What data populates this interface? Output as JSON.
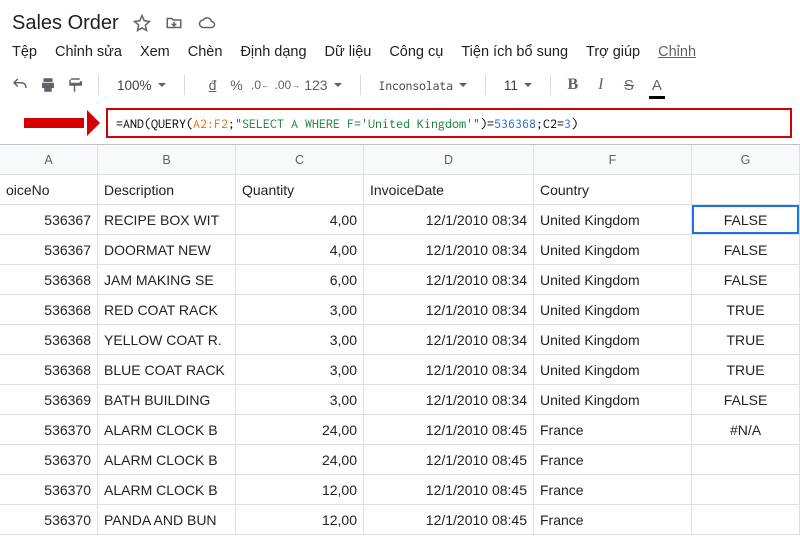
{
  "document": {
    "title": "Sales Order"
  },
  "menus": {
    "file": "Tệp",
    "edit": "Chỉnh sửa",
    "view": "Xem",
    "insert": "Chèn",
    "format": "Định dạng",
    "data": "Dữ liệu",
    "tools": "Công cụ",
    "addons": "Tiện ích bổ sung",
    "help": "Trợ giúp",
    "overflow": "Chỉnh"
  },
  "toolbar": {
    "zoom": "100%",
    "currency": "đ",
    "percent": "%",
    "dec_dec": ".0",
    "dec_inc": ".00",
    "num_format": "123",
    "font_name": "Inconsolata",
    "font_size": "11",
    "bold": "B",
    "italic": "I",
    "strike": "S",
    "text_color": "A"
  },
  "formula": {
    "p1": "=AND(QUERY(",
    "range": "A2:F2",
    "p2": ";",
    "str": "\"SELECT A WHERE F='United Kingdom'\"",
    "p3": ")=",
    "num1": "536368",
    "p4": ";C2=",
    "num2": "3",
    "p5": ")"
  },
  "columns": {
    "A": "A",
    "B": "B",
    "C": "C",
    "D": "D",
    "F": "F",
    "G": "G"
  },
  "headers": {
    "A": "oiceNo",
    "B": "Description",
    "C": "Quantity",
    "D": "InvoiceDate",
    "F": "Country",
    "G": ""
  },
  "rows": [
    {
      "A": "536367",
      "B": "RECIPE BOX WIT",
      "C": "4,00",
      "D": "12/1/2010 08:34",
      "F": "United Kingdom",
      "G": "FALSE",
      "sel": true
    },
    {
      "A": "536367",
      "B": "DOORMAT NEW",
      "C": "4,00",
      "D": "12/1/2010 08:34",
      "F": "United Kingdom",
      "G": "FALSE"
    },
    {
      "A": "536368",
      "B": "JAM MAKING SE",
      "C": "6,00",
      "D": "12/1/2010 08:34",
      "F": "United Kingdom",
      "G": "FALSE"
    },
    {
      "A": "536368",
      "B": "RED COAT RACK",
      "C": "3,00",
      "D": "12/1/2010 08:34",
      "F": "United Kingdom",
      "G": "TRUE"
    },
    {
      "A": "536368",
      "B": "YELLOW COAT R.",
      "C": "3,00",
      "D": "12/1/2010 08:34",
      "F": "United Kingdom",
      "G": "TRUE"
    },
    {
      "A": "536368",
      "B": "BLUE COAT RACK",
      "C": "3,00",
      "D": "12/1/2010 08:34",
      "F": "United Kingdom",
      "G": "TRUE"
    },
    {
      "A": "536369",
      "B": "BATH BUILDING",
      "C": "3,00",
      "D": "12/1/2010 08:34",
      "F": "United Kingdom",
      "G": "FALSE"
    },
    {
      "A": "536370",
      "B": "ALARM CLOCK B",
      "C": "24,00",
      "D": "12/1/2010 08:45",
      "F": "France",
      "G": "#N/A"
    },
    {
      "A": "536370",
      "B": "ALARM CLOCK B",
      "C": "24,00",
      "D": "12/1/2010 08:45",
      "F": "France",
      "G": ""
    },
    {
      "A": "536370",
      "B": "ALARM CLOCK B",
      "C": "12,00",
      "D": "12/1/2010 08:45",
      "F": "France",
      "G": ""
    },
    {
      "A": "536370",
      "B": "PANDA AND BUN",
      "C": "12,00",
      "D": "12/1/2010 08:45",
      "F": "France",
      "G": ""
    }
  ]
}
